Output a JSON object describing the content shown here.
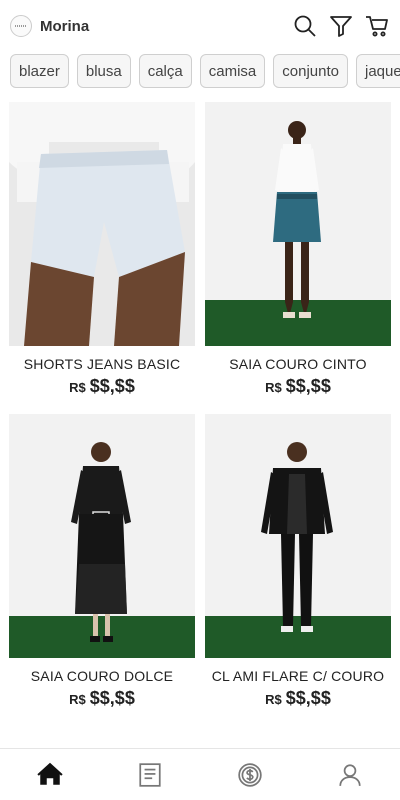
{
  "header": {
    "brand": "Morina",
    "icons": [
      "search-icon",
      "filter-icon",
      "cart-icon"
    ]
  },
  "categories": [
    "blazer",
    "blusa",
    "calça",
    "camisa",
    "conjunto",
    "jaque"
  ],
  "products": [
    {
      "title": "SHORTS JEANS BASIC",
      "currency": "R$",
      "price": "$$,$$"
    },
    {
      "title": "SAIA COURO CINTO",
      "currency": "R$",
      "price": "$$,$$"
    },
    {
      "title": "SAIA COURO DOLCE",
      "currency": "R$",
      "price": "$$,$$"
    },
    {
      "title": "CL AMI FLARE C/ COURO",
      "currency": "R$",
      "price": "$$,$$"
    }
  ],
  "tabbar": {
    "icons": [
      "home-icon",
      "orders-icon",
      "money-icon",
      "profile-icon"
    ],
    "active": "home-icon"
  },
  "colors": {
    "floor": "#1f5a28",
    "text": "#222222"
  }
}
